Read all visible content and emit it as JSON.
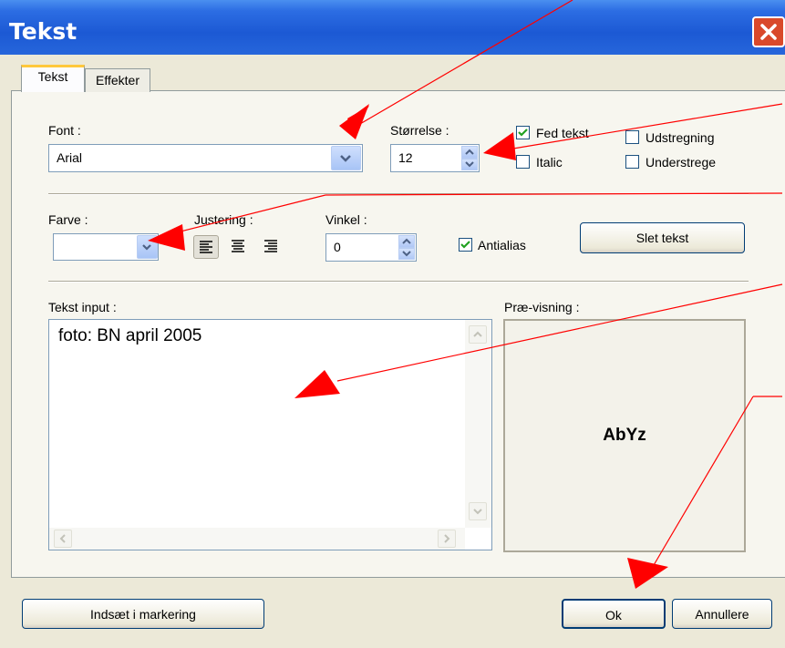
{
  "window": {
    "title": "Tekst"
  },
  "tabs": [
    {
      "label": "Tekst"
    },
    {
      "label": "Effekter"
    }
  ],
  "font": {
    "label": "Font :",
    "value": "Arial"
  },
  "size": {
    "label": "Størrelse :",
    "value": "12"
  },
  "style_options": {
    "bold": {
      "label": "Fed tekst",
      "checked": true
    },
    "italic": {
      "label": "Italic",
      "checked": false
    },
    "strikethrough": {
      "label": "Udstregning",
      "checked": false
    },
    "underline": {
      "label": "Understrege",
      "checked": false
    }
  },
  "color": {
    "label": "Farve :",
    "value": ""
  },
  "alignment": {
    "label": "Justering :",
    "selected": "left",
    "options": [
      "left",
      "center",
      "right"
    ]
  },
  "angle": {
    "label": "Vinkel :",
    "value": "0"
  },
  "antialias": {
    "label": "Antialias",
    "checked": true
  },
  "buttons": {
    "delete_text": "Slet tekst",
    "insert_selection": "Indsæt i markering",
    "ok": "Ok",
    "cancel": "Annullere"
  },
  "text_input": {
    "label": "Tekst input :",
    "value": "foto: BN april 2005"
  },
  "preview": {
    "label": "Præ-visning :",
    "sample": "AbYz"
  },
  "annotation": {
    "arrow_color": "#ff0000"
  }
}
